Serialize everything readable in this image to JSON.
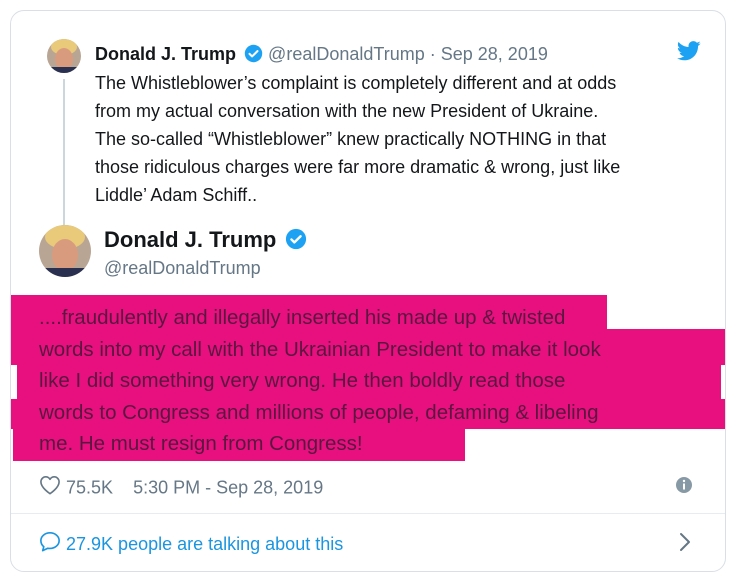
{
  "parent_tweet": {
    "name": "Donald J. Trump",
    "handle": "@realDonaldTrump",
    "separator": "·",
    "date": "Sep 28, 2019",
    "lines": [
      "The Whistleblower’s complaint is completely different and at odds",
      "from my actual conversation with the new President of Ukraine.",
      "The so-called “Whistleblower” knew practically NOTHING in that",
      "those ridiculous charges were far more dramatic & wrong, just like",
      "Liddle’ Adam Schiff.."
    ]
  },
  "main_tweet": {
    "name": "Donald J. Trump",
    "handle": "@realDonaldTrump",
    "lines": [
      "....fraudulently and illegally inserted his made up & twisted",
      "words into my call with the Ukrainian President to make it look",
      "like I did something very wrong. He then boldly read those",
      "words to Congress and millions of people, defaming & libeling",
      "me. He must resign from Congress!"
    ],
    "likes": "75.5K",
    "time": "5:30 PM - Sep 28, 2019",
    "talking": "27.9K people are talking about this"
  },
  "colors": {
    "highlight": "#e8107f",
    "link": "#1b95e0",
    "verified": "#1da1f2",
    "muted": "#657786"
  },
  "icons": [
    "avatar",
    "verified-badge-icon",
    "twitter-bird-icon",
    "heart-icon",
    "info-icon",
    "comment-bubble-icon",
    "chevron-right-icon"
  ]
}
